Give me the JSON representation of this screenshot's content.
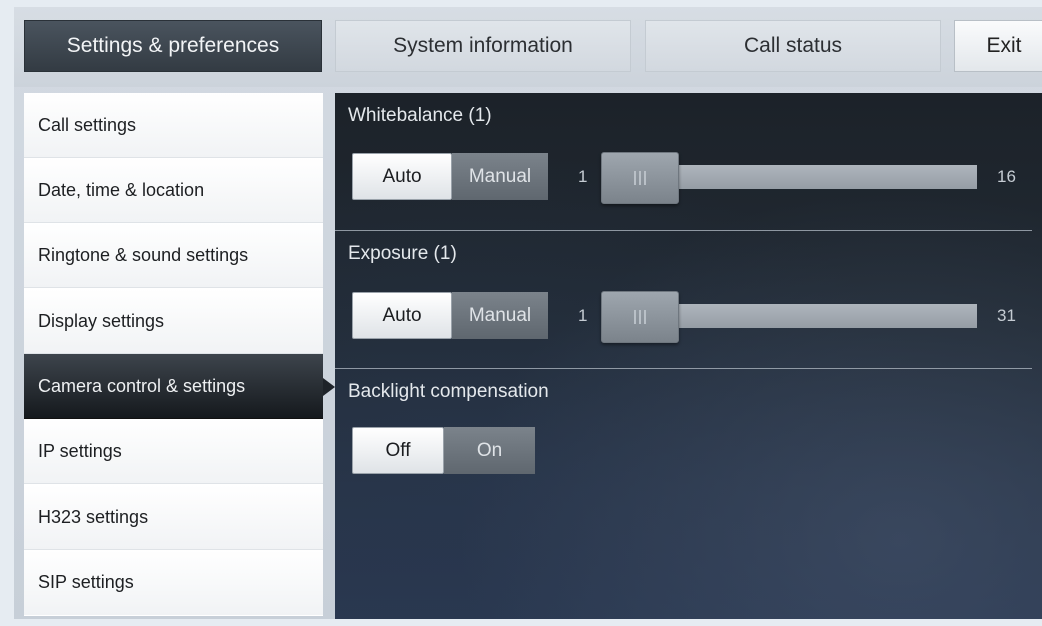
{
  "tabs": [
    {
      "label": "Settings & preferences",
      "active": true
    },
    {
      "label": "System information"
    },
    {
      "label": "Call status"
    },
    {
      "label": "Exit"
    }
  ],
  "menu": {
    "items": [
      {
        "label": "Call settings"
      },
      {
        "label": "Date, time & location"
      },
      {
        "label": "Ringtone & sound settings"
      },
      {
        "label": "Display settings"
      },
      {
        "label": "Camera control & settings",
        "active": true
      },
      {
        "label": "IP settings"
      },
      {
        "label": "H323 settings"
      },
      {
        "label": "SIP settings"
      }
    ]
  },
  "whitebalance": {
    "title": "Whitebalance (1)",
    "auto_label": "Auto",
    "manual_label": "Manual",
    "selected": "Auto",
    "min": "1",
    "max": "16",
    "value": 1
  },
  "exposure": {
    "title": "Exposure (1)",
    "auto_label": "Auto",
    "manual_label": "Manual",
    "selected": "Auto",
    "min": "1",
    "max": "31",
    "value": 1
  },
  "backlight": {
    "title": "Backlight compensation",
    "off_label": "Off",
    "on_label": "On",
    "selected": "Off"
  },
  "colors": {
    "active_tab": "#3c444c",
    "selected_menu": "#1e2329",
    "content_bg": "#222b35"
  }
}
